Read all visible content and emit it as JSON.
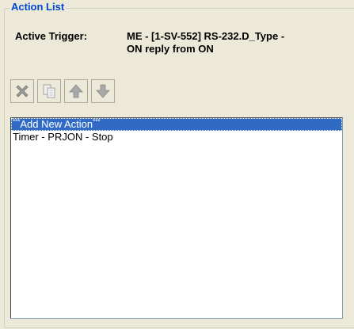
{
  "group": {
    "title": "Action List"
  },
  "trigger": {
    "label": "Active Trigger:",
    "value_line1": "ME - [1-SV-552] RS-232.D_Type -",
    "value_line2": "ON reply from ON"
  },
  "toolbar": {
    "delete_icon": "delete-x-icon",
    "copy_icon": "copy-icon",
    "move_up_icon": "arrow-up-icon",
    "move_down_icon": "arrow-down-icon"
  },
  "actions": {
    "items": [
      {
        "prefix": "***",
        "label": "Add New Action",
        "suffix": "***",
        "selected": true
      },
      {
        "label": "Timer - PRJON - Stop",
        "selected": false
      }
    ]
  },
  "colors": {
    "title": "#0046d5",
    "selection": "#316ac5",
    "background": "#ece9d8",
    "disabled_icon": "#a0a0a0"
  }
}
